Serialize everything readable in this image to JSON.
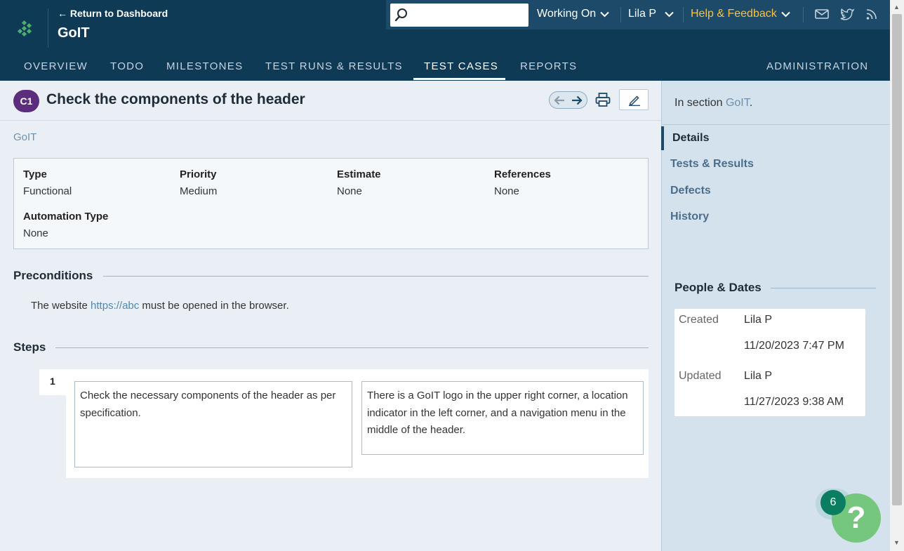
{
  "header": {
    "return_link": "← Return to Dashboard",
    "project_title": "GoIT",
    "search_placeholder": "",
    "working_on": "Working On",
    "user": "Lila P",
    "help": "Help & Feedback"
  },
  "nav": {
    "overview": "OVERVIEW",
    "todo": "TODO",
    "milestones": "MILESTONES",
    "test_runs": "TEST RUNS & RESULTS",
    "test_cases": "TEST CASES",
    "reports": "REPORTS",
    "administration": "ADMINISTRATION"
  },
  "case": {
    "id": "C1",
    "title": "Check the components of the header",
    "breadcrumb": "GoIT"
  },
  "fields": {
    "type_label": "Type",
    "type_value": "Functional",
    "priority_label": "Priority",
    "priority_value": "Medium",
    "estimate_label": "Estimate",
    "estimate_value": "None",
    "references_label": "References",
    "references_value": "None",
    "automation_label": "Automation Type",
    "automation_value": "None"
  },
  "preconditions": {
    "title": "Preconditions",
    "text_before": "The website ",
    "link": "https://abc",
    "text_after": " must be opened in the browser."
  },
  "steps": {
    "title": "Steps",
    "items": [
      {
        "number": "1",
        "content": "Check the necessary components of the header as per specification.",
        "expected": "There is a GoIT logo in the upper right corner, a location indicator in the left corner, and a navigation menu in the middle of the header."
      }
    ]
  },
  "sidebar": {
    "section_prefix": "In section ",
    "section_link": "GoIT",
    "section_suffix": ".",
    "tabs": [
      "Details",
      "Tests & Results",
      "Defects",
      "History"
    ],
    "people_dates_title": "People & Dates",
    "created_label": "Created",
    "created_by": "Lila P",
    "created_date": "11/20/2023 7:47 PM",
    "updated_label": "Updated",
    "updated_by": "Lila P",
    "updated_date": "11/27/2023 9:38 AM"
  },
  "help_widget": {
    "badge_count": "6",
    "symbol": "?"
  },
  "colors": {
    "header_bg": "#0f3a56",
    "accent_help": "#f7c244",
    "case_badge": "#5b2d7c",
    "link": "#4f88b2",
    "help_bubble": "#74c77d"
  }
}
